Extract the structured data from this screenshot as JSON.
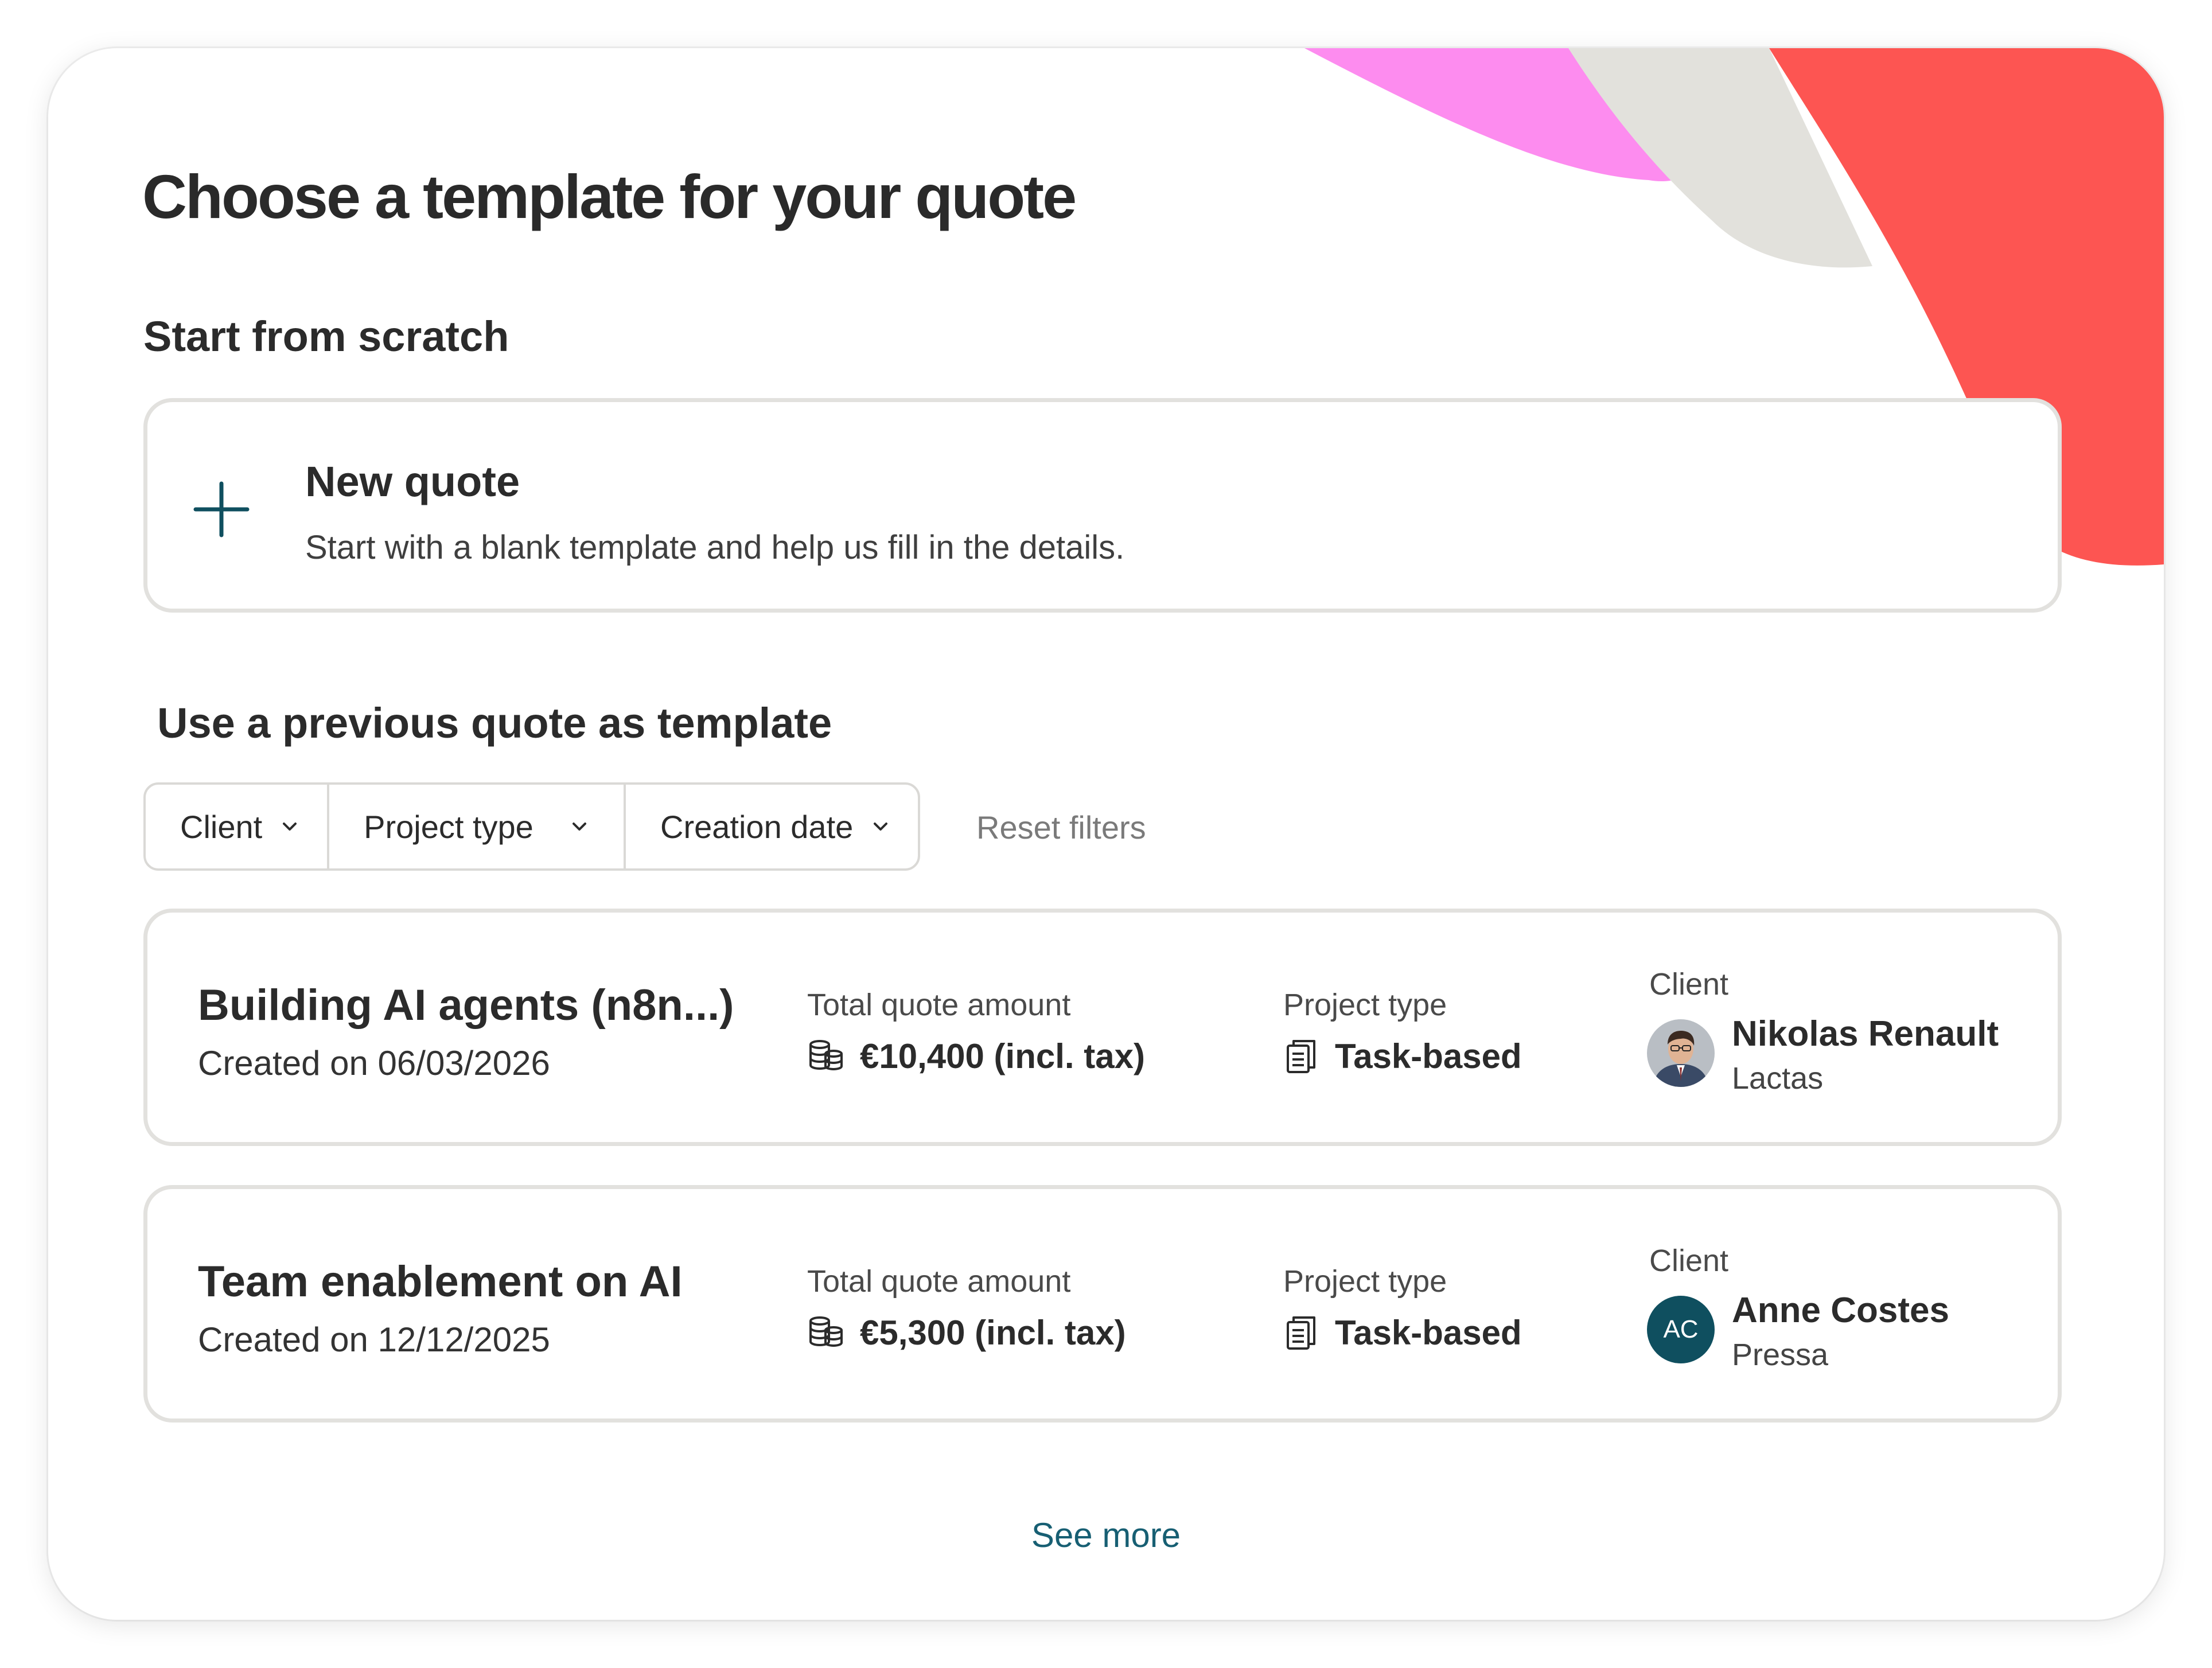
{
  "page": {
    "title": "Choose a template for your quote",
    "scratch_heading": "Start from scratch",
    "previous_heading": "Use a previous quote as template",
    "see_more": "See more"
  },
  "new_quote": {
    "title": "New quote",
    "description": "Start with a blank template and help us fill in the details.",
    "icon": "plus-icon"
  },
  "filters": {
    "client": "Client",
    "project_type": "Project type",
    "creation_date": "Creation date",
    "reset": "Reset filters"
  },
  "quotes": [
    {
      "title": "Building AI agents (n8n...)",
      "created": "Created on 06/03/2026",
      "amount_label": "Total quote amount",
      "amount": "€10,400 (incl. tax)",
      "type_label": "Project type",
      "type": "Task-based",
      "client_label": "Client",
      "client_name": "Nikolas Renault",
      "client_company": "Lactas"
    },
    {
      "title": "Team enablement on AI",
      "created": "Created on 12/12/2025",
      "amount_label": "Total quote amount",
      "amount": "€5,300 (incl. tax)",
      "type_label": "Project type",
      "type": "Task-based",
      "client_label": "Client",
      "client_name": "Anne Costes",
      "client_initials": "AC",
      "client_company": "Pressa"
    }
  ],
  "colors": {
    "accent_teal": "#0f4f5f",
    "link": "#175f73",
    "deco_pink": "#fd8cef",
    "deco_grey": "#e2e1dc",
    "deco_red": "#fd5552"
  }
}
